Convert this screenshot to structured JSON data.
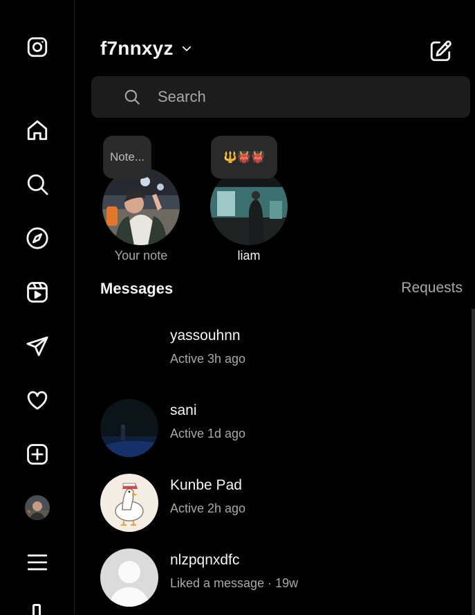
{
  "account": {
    "username": "f7nnxyz"
  },
  "search": {
    "placeholder": "Search"
  },
  "nav": {
    "items": [
      "instagram-logo-icon",
      "home-icon",
      "search-icon",
      "explore-compass-icon",
      "reels-icon",
      "direct-send-icon",
      "heart-notifications-icon",
      "create-plus-icon",
      "profile-avatar",
      "menu-hamburger-icon"
    ]
  },
  "notes": [
    {
      "bubble": "Note...",
      "label": "Your note"
    },
    {
      "bubble": "🔱👹👹",
      "label": "liam"
    }
  ],
  "inbox": {
    "title": "Messages",
    "requests_label": "Requests",
    "threads": [
      {
        "name": "yassouhnn",
        "status": "Active 3h ago"
      },
      {
        "name": "sani",
        "status": "Active 1d ago"
      },
      {
        "name": "Kunbe Pad",
        "status": "Active 2h ago"
      },
      {
        "name": "nlzpqnxdfc",
        "status": "Liked a message · 19w"
      }
    ]
  },
  "colors": {
    "background": "#000000",
    "text_primary": "#f5f5f5",
    "text_secondary": "#a8a8a8",
    "surface": "#1c1c1c",
    "note_bubble": "#2a2a2a"
  }
}
